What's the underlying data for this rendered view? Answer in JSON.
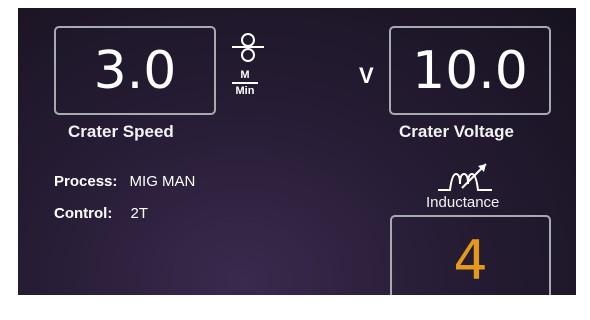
{
  "crater_speed": {
    "value": "3.0",
    "label": "Crater Speed",
    "unit_top": "M",
    "unit_bottom": "Min",
    "icon": "wire-spool-icon"
  },
  "crater_voltage": {
    "value": "10.0",
    "label": "Crater Voltage",
    "unit": "V"
  },
  "info": {
    "process_label": "Process:",
    "process_value": "MIG MAN",
    "control_label": "Control:",
    "control_value": "2T"
  },
  "inductance": {
    "label": "Inductance",
    "value": "4",
    "icon": "inductance-icon",
    "value_color": "#e39a1c"
  }
}
